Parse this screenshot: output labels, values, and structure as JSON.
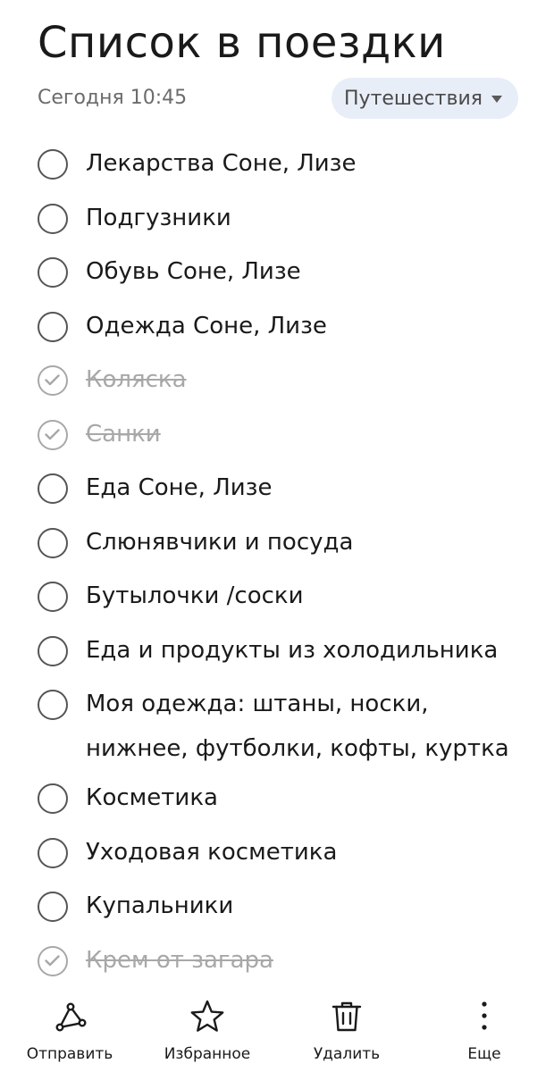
{
  "header": {
    "title": "Список в поездки",
    "date": "Сегодня 10:45",
    "category": "Путешествия"
  },
  "items": [
    {
      "text": "Лекарства Соне, Лизе",
      "done": false
    },
    {
      "text": "Подгузники",
      "done": false
    },
    {
      "text": "Обувь Соне, Лизе",
      "done": false
    },
    {
      "text": "Одежда Соне, Лизе",
      "done": false
    },
    {
      "text": "Коляска",
      "done": true
    },
    {
      "text": "Санки",
      "done": true
    },
    {
      "text": "Еда Соне, Лизе",
      "done": false
    },
    {
      "text": "Слюнявчики и посуда",
      "done": false
    },
    {
      "text": "Бутылочки /соски",
      "done": false
    },
    {
      "text": "Еда и продукты из холодильника",
      "done": false
    },
    {
      "text": "Моя одежда: штаны, носки, нижнее, футболки, кофты, куртка",
      "done": false
    },
    {
      "text": "Косметика",
      "done": false
    },
    {
      "text": "Уходовая косметика",
      "done": false
    },
    {
      "text": "Купальники",
      "done": false
    },
    {
      "text": "Крем от загара",
      "done": true
    }
  ],
  "toolbar": {
    "share_label": "Отправить",
    "share_icon": "share-icon",
    "favorite_label": "Избранное",
    "favorite_icon": "star-icon",
    "delete_label": "Удалить",
    "delete_icon": "trash-icon",
    "more_label": "Еще",
    "more_icon": "more-vertical-icon"
  },
  "colors": {
    "text": "#1a1a1a",
    "muted": "#6b6b6b",
    "done": "#a8a8a8",
    "chip_bg": "#e8eef8"
  }
}
